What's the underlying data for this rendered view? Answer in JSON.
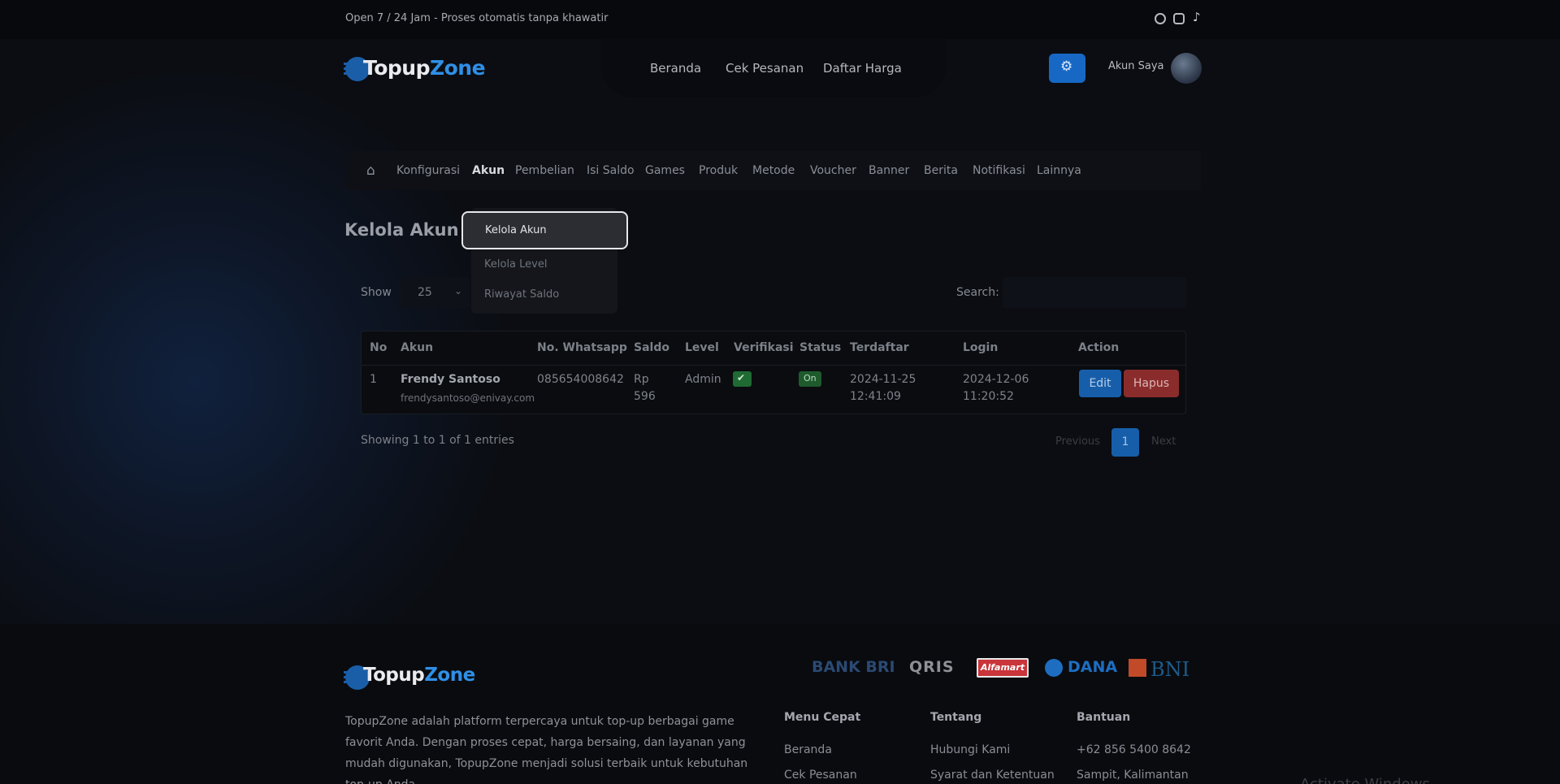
{
  "topbar": {
    "text": "Open 7 / 24 Jam - Proses otomatis tanpa khawatir",
    "icons": [
      "whatsapp-icon",
      "instagram-icon",
      "tiktok-icon"
    ]
  },
  "header": {
    "logo_part1": "Topup",
    "logo_part2": "Zone",
    "nav": [
      "Beranda",
      "Cek Pesanan",
      "Daftar Harga"
    ],
    "account_label": "Akun Saya"
  },
  "admin_menu": {
    "items": [
      "Konfigurasi",
      "Akun",
      "Pembelian",
      "Isi Saldo",
      "Games",
      "Produk",
      "Metode",
      "Voucher",
      "Banner",
      "Berita",
      "Notifikasi",
      "Lainnya"
    ],
    "active": "Akun"
  },
  "dropdown": {
    "items": [
      "Kelola Akun",
      "Kelola Level",
      "Riwayat Saldo"
    ],
    "active": "Kelola Akun"
  },
  "page": {
    "title": "Kelola Akun",
    "show_label": "Show",
    "show_value": "25",
    "search_label": "Search:",
    "search_value": ""
  },
  "table": {
    "columns": [
      "No",
      "Akun",
      "No. Whatsapp",
      "Saldo",
      "Level",
      "Verifikasi",
      "Status",
      "Terdaftar",
      "Login",
      "Action"
    ],
    "rows": [
      {
        "no": "1",
        "name": "Frendy Santoso",
        "email": "frendysantoso@enivay.com",
        "whatsapp": "085654008642",
        "saldo_line1": "Rp",
        "saldo_line2": "596",
        "level": "Admin",
        "status": "On",
        "terdaftar_date": "2024-11-25",
        "terdaftar_time": "12:41:09",
        "login_date": "2024-12-06",
        "login_time": "11:20:52",
        "edit_label": "Edit",
        "delete_label": "Hapus"
      }
    ]
  },
  "pagination": {
    "info": "Showing 1 to 1 of 1 entries",
    "previous": "Previous",
    "current": "1",
    "next": "Next"
  },
  "footer": {
    "logo_part1": "Topup",
    "logo_part2": "Zone",
    "payments": [
      "BANK BRI",
      "QRIS",
      "Alfamart",
      "DANA",
      "BNI"
    ],
    "description": "TopupZone adalah platform terpercaya untuk top-up berbagai game favorit Anda. Dengan proses cepat, harga bersaing, dan layanan yang mudah digunakan, TopupZone menjadi solusi terbaik untuk kebutuhan top-up Anda.",
    "menu_cepat": {
      "title": "Menu Cepat",
      "items": [
        "Beranda",
        "Cek Pesanan"
      ]
    },
    "tentang": {
      "title": "Tentang",
      "items": [
        "Hubungi Kami",
        "Syarat dan Ketentuan"
      ]
    },
    "bantuan": {
      "title": "Bantuan",
      "items": [
        "+62 856 5400 8642",
        "Sampit, Kalimantan"
      ]
    }
  },
  "os_watermark": "Activate Windows",
  "colors": {
    "primary": "#175eaa",
    "danger": "#8b2c2c",
    "success": "#1f6b33",
    "background": "#0b0d12"
  }
}
